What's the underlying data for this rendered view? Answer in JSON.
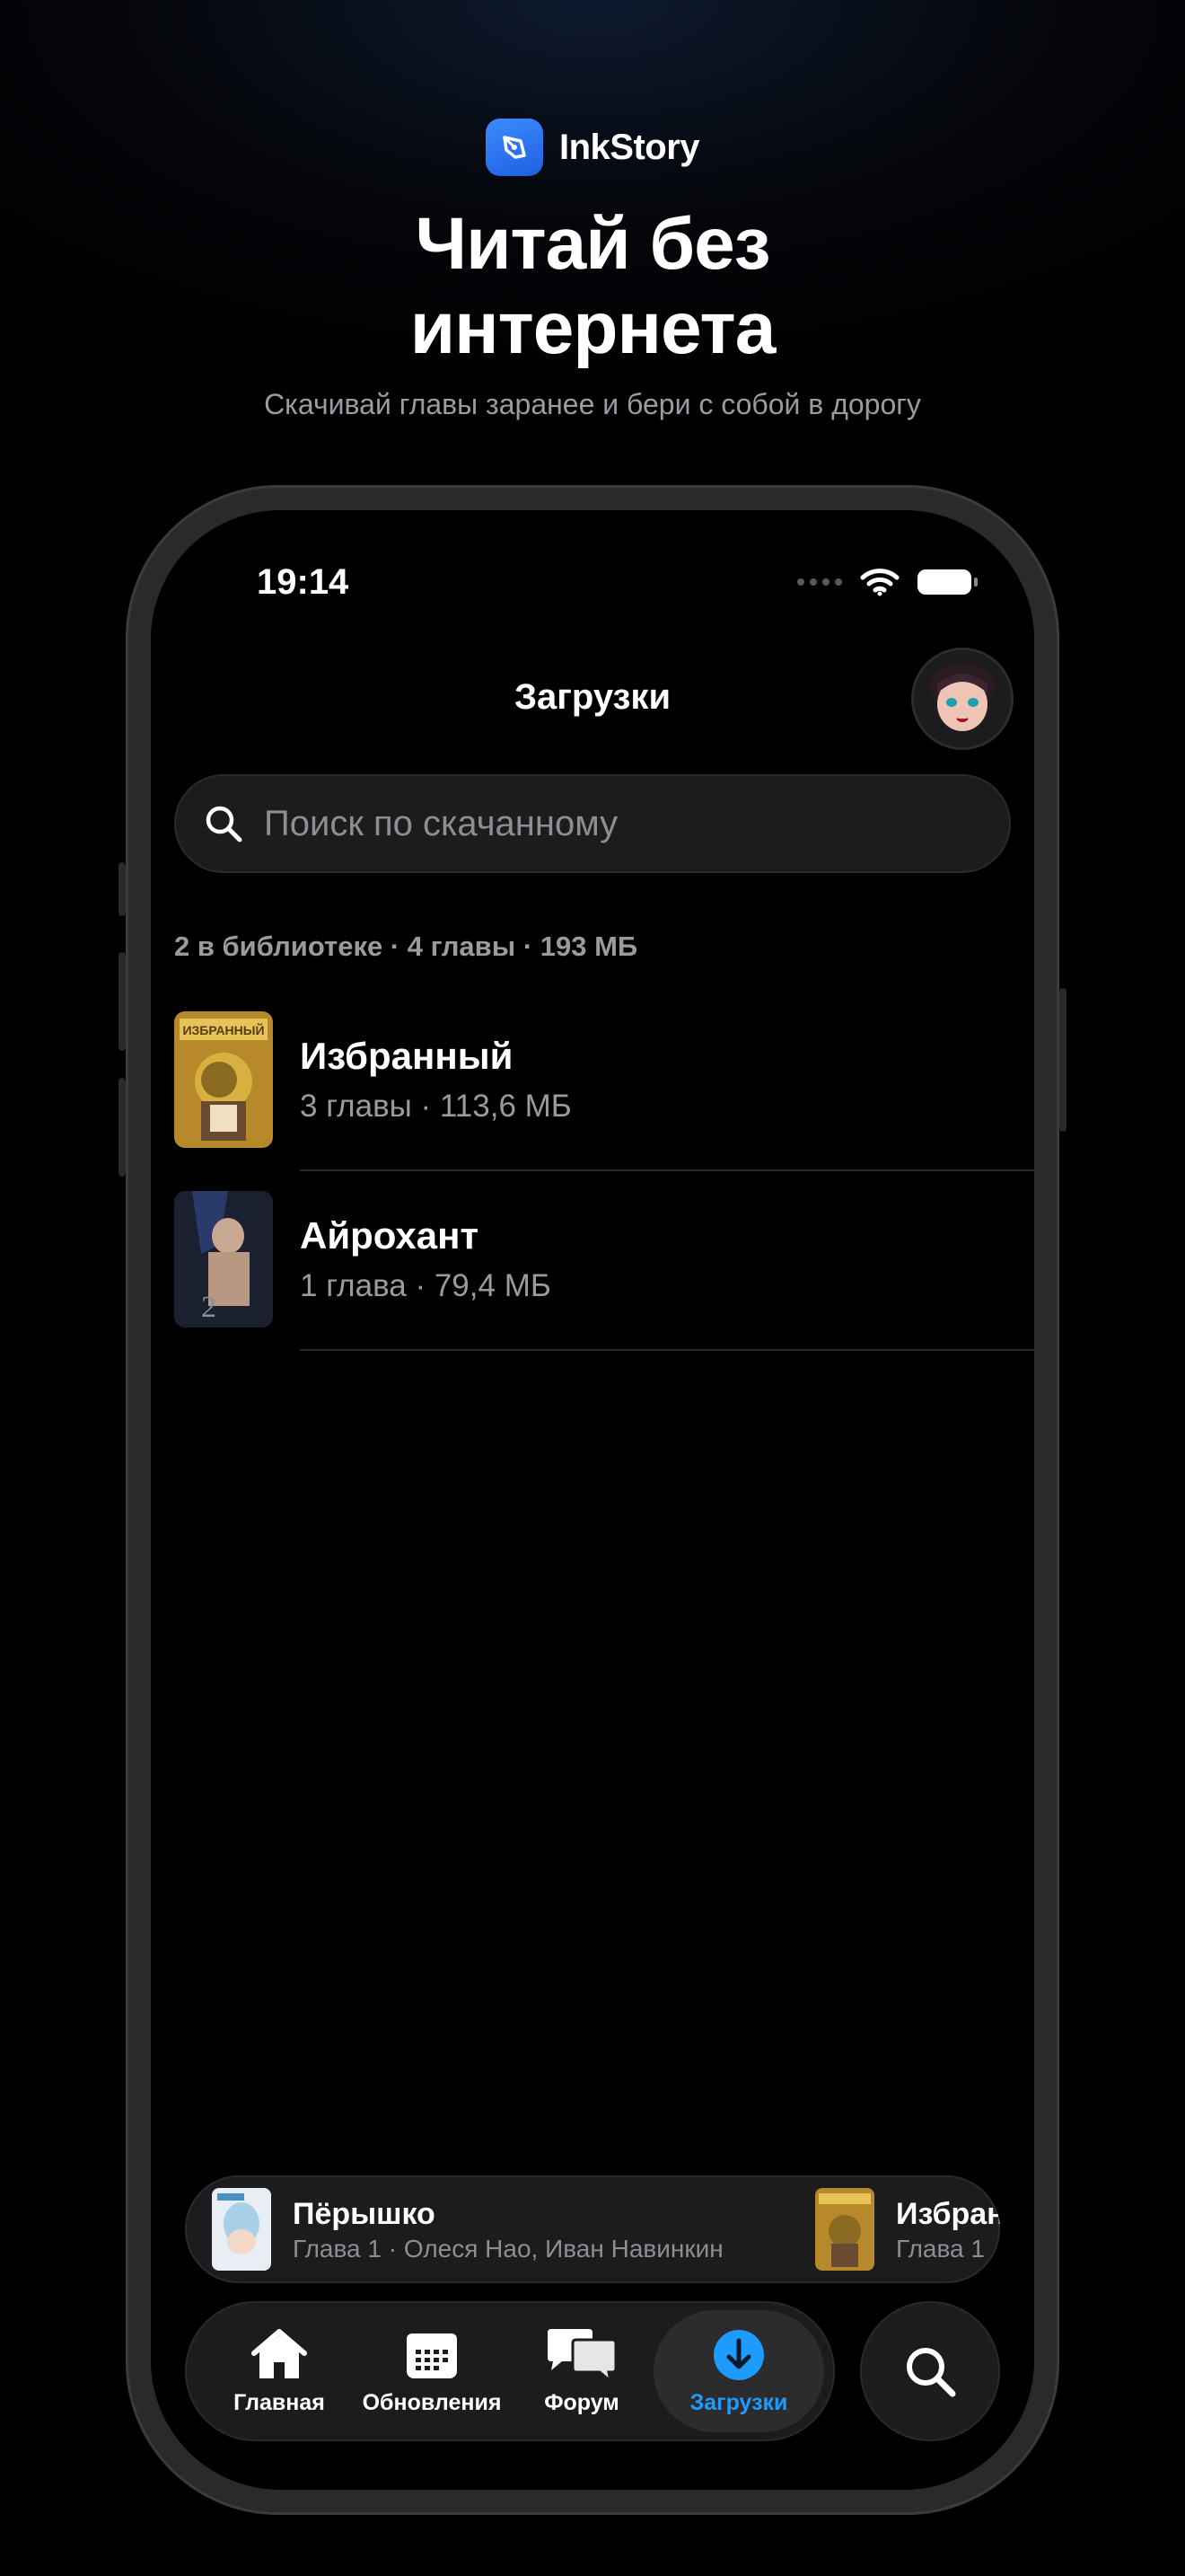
{
  "promo": {
    "brand_name": "InkStory",
    "headline_line1": "Читай без",
    "headline_line2": "интернета",
    "subheadline": "Скачивай главы заранее и бери с собой в дорогу"
  },
  "status_bar": {
    "time": "19:14"
  },
  "screen": {
    "title": "Загрузки",
    "search_placeholder": "Поиск по скачанному",
    "summary": "2 в библиотеке · 4 главы · 193 МБ"
  },
  "downloads": [
    {
      "title": "Избранный",
      "subtitle": "3 главы · 113,6 МБ",
      "cover_label": "ИЗБРАННЫЙ"
    },
    {
      "title": "Айрохант",
      "subtitle": "1 глава · 79,4 МБ",
      "cover_label": "2"
    }
  ],
  "mini_player": [
    {
      "title": "Пёрышко",
      "subtitle": "Глава 1 · Олеся Нао, Иван Навинкин"
    },
    {
      "title": "Избранный",
      "subtitle": "Глава 1"
    }
  ],
  "tabs": [
    {
      "label": "Главная",
      "icon": "home-icon"
    },
    {
      "label": "Обновления",
      "icon": "calendar-icon"
    },
    {
      "label": "Форум",
      "icon": "chat-bubbles-icon"
    },
    {
      "label": "Загрузки",
      "icon": "download-icon",
      "active": true
    }
  ],
  "colors": {
    "accent": "#1e9bff",
    "brand": "#2f7bff",
    "background": "#000000",
    "surface": "#1c1c1e"
  }
}
